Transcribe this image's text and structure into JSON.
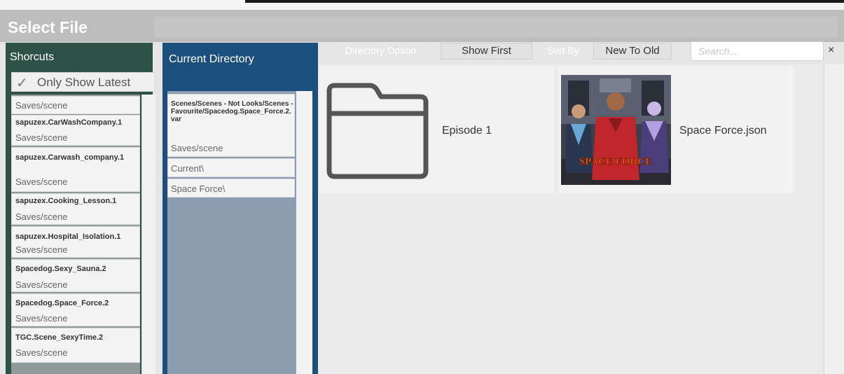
{
  "dialog": {
    "title": "Select File"
  },
  "shortcuts": {
    "header": "Shorcuts",
    "only_latest_label": "Only Show Latest",
    "only_latest_checked": true,
    "items": [
      {
        "name": "",
        "path": "Saves/scene"
      },
      {
        "name": "sapuzex.CarWashCompany.1",
        "path": "Saves/scene"
      },
      {
        "name": "sapuzex.Carwash_company.1",
        "path": "Saves/scene"
      },
      {
        "name": "sapuzex.Cooking_Lesson.1",
        "path": "Saves/scene"
      },
      {
        "name": "sapuzex.Hospital_Isolation.1",
        "path": "Saves/scene"
      },
      {
        "name": "Spacedog.Sexy_Sauna.2",
        "path": "Saves/scene"
      },
      {
        "name": "Spacedog.Space_Force.2",
        "path": "Saves/scene"
      },
      {
        "name": "TGC.Scene_SexyTime.2",
        "path": "Saves/scene"
      }
    ]
  },
  "current_directory": {
    "header": "Current Directory",
    "items": [
      {
        "name": "Scenes/Scenes - Not Looks/Scenes - Favourite/Spacedog.Space_Force.2.var",
        "path": "Saves/scene"
      },
      {
        "name": "",
        "path": "Current\\"
      },
      {
        "name": "",
        "path": "Space Force\\"
      }
    ]
  },
  "toolbar": {
    "directory_option_label": "Directory Option",
    "directory_option_value": "Show First",
    "sort_by_label": "Sort By",
    "sort_by_value": "New To Old",
    "search_placeholder": "Search...",
    "clear_symbol": "×"
  },
  "files": [
    {
      "type": "folder",
      "icon": "folder-icon",
      "name": "Episode 1"
    },
    {
      "type": "file",
      "thumbnail_text": "SPACE FORCE",
      "name": "Space Force.json"
    }
  ],
  "colors": {
    "shortcuts_panel": "#2f5248",
    "current_directory_panel": "#1d4f7c",
    "title_bar": "#bdbdbd"
  }
}
